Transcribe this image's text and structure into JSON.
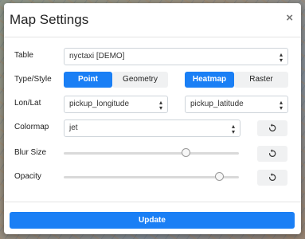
{
  "modal": {
    "title": "Map Settings",
    "close_glyph": "×"
  },
  "fields": {
    "table": {
      "label": "Table",
      "value": "nyctaxi [DEMO]"
    },
    "type_style": {
      "label": "Type/Style",
      "type_options": [
        {
          "label": "Point",
          "active": true
        },
        {
          "label": "Geometry",
          "active": false
        }
      ],
      "style_options": [
        {
          "label": "Heatmap",
          "active": true
        },
        {
          "label": "Raster",
          "active": false
        }
      ]
    },
    "lon_lat": {
      "label": "Lon/Lat",
      "lon_value": "pickup_longitude",
      "lat_value": "pickup_latitude"
    },
    "colormap": {
      "label": "Colormap",
      "value": "jet"
    },
    "blur_size": {
      "label": "Blur Size",
      "fraction": 0.7
    },
    "opacity": {
      "label": "Opacity",
      "fraction": 0.89
    }
  },
  "footer": {
    "update_label": "Update"
  },
  "icons": {
    "select_caret": "chevron-updown-icon",
    "reset": "reset-icon",
    "close": "close-icon"
  },
  "colors": {
    "accent": "#1a7ff5"
  }
}
